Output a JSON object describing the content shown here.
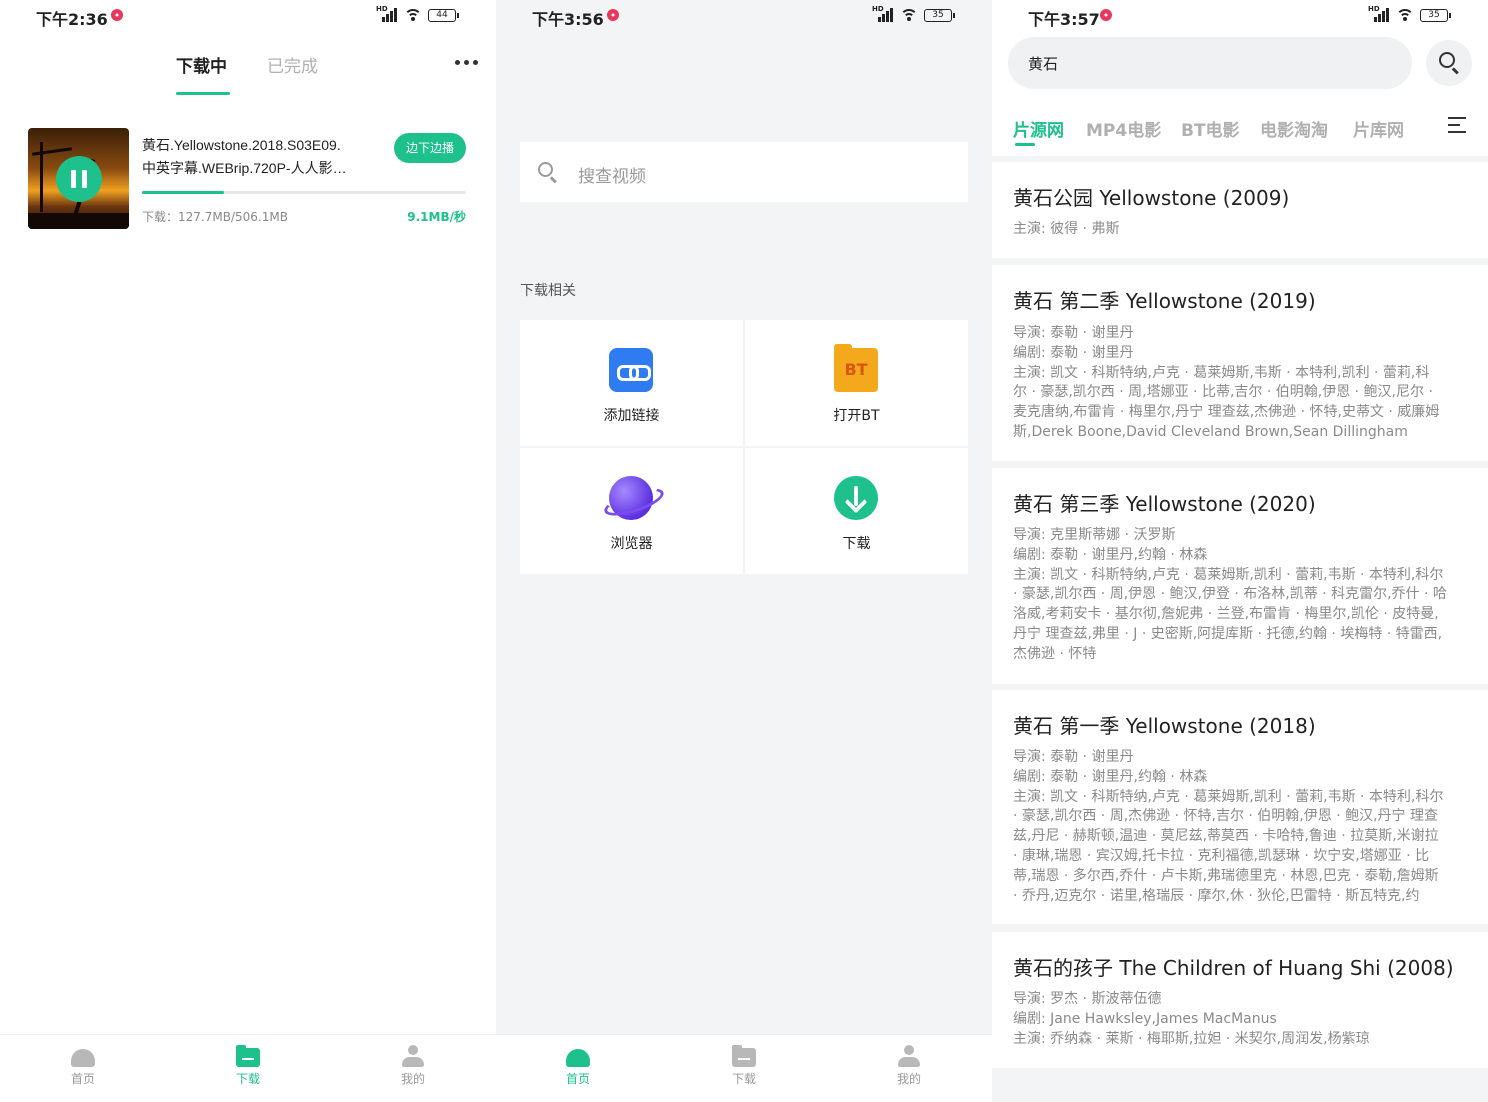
{
  "panel1": {
    "status": {
      "time": "下午2:36",
      "battery": "44"
    },
    "tabs": [
      "下载中",
      "已完成"
    ],
    "item": {
      "title_line1": "黄石.Yellowstone.2018.S03E09.",
      "title_line2": "中英字幕.WEBrip.720P-人人影…",
      "stream_button": "边下边播",
      "size": "下载：127.7MB/506.1MB",
      "speed": "9.1MB/秒",
      "progress": 0.252
    },
    "nav": [
      "首页",
      "下载",
      "我的"
    ]
  },
  "panel2": {
    "status": {
      "time": "下午3:56",
      "battery": "35"
    },
    "search_placeholder": "搜查视频",
    "section_title": "下载相关",
    "grid": [
      {
        "label": "添加链接",
        "icon": "link-icon"
      },
      {
        "label": "打开BT",
        "icon": "bt-folder-icon"
      },
      {
        "label": "浏览器",
        "icon": "planet-icon"
      },
      {
        "label": "下载",
        "icon": "download-icon"
      }
    ],
    "bt_glyph": "BT",
    "nav": [
      "首页",
      "下载",
      "我的"
    ]
  },
  "panel3": {
    "status": {
      "time": "下午3:57",
      "battery": "35"
    },
    "search_value": "黄石",
    "source_tabs": [
      "片源网",
      "MP4电影",
      "BT电影",
      "电影淘淘",
      "片库网"
    ],
    "results": [
      {
        "title": "黄石公园 Yellowstone (2009)",
        "lines": [
          "主演: 彼得 · 弗斯"
        ]
      },
      {
        "title": "黄石 第二季 Yellowstone (2019)",
        "lines": [
          "导演: 泰勒 · 谢里丹",
          "编剧: 泰勒 · 谢里丹",
          "主演: 凯文 · 科斯特纳,卢克 · 葛莱姆斯,韦斯 · 本特利,凯利 · 蕾莉,科",
          "尔 · 豪瑟,凯尔西 · 周,塔娜亚 · 比蒂,吉尔 · 伯明翰,伊恩 · 鲍汉,尼尔 ·",
          "麦克唐纳,布雷肯 · 梅里尔,丹宁 理查兹,杰佛逊 · 怀特,史蒂文 · 威廉姆",
          "斯,Derek Boone,David Cleveland Brown,Sean Dillingham"
        ]
      },
      {
        "title": "黄石 第三季 Yellowstone (2020)",
        "lines": [
          "导演: 克里斯蒂娜 · 沃罗斯",
          "编剧: 泰勒 · 谢里丹,约翰 · 林森",
          "主演: 凯文 · 科斯特纳,卢克 · 葛莱姆斯,凯利 · 蕾莉,韦斯 · 本特利,科尔",
          "· 豪瑟,凯尔西 · 周,伊恩 · 鲍汉,伊登 · 布洛林,凯蒂 · 科克雷尔,乔什 · 哈",
          "洛威,考莉安卡 · 基尔彻,詹妮弗 · 兰登,布雷肯 · 梅里尔,凯伦 · 皮特曼,",
          "丹宁 理查兹,弗里 · J · 史密斯,阿提库斯 · 托德,约翰 · 埃梅特 · 特雷西,",
          "杰佛逊 · 怀特"
        ]
      },
      {
        "title": "黄石 第一季 Yellowstone (2018)",
        "lines": [
          "导演: 泰勒 · 谢里丹",
          "编剧: 泰勒 · 谢里丹,约翰 · 林森",
          "主演: 凯文 · 科斯特纳,卢克 · 葛莱姆斯,凯利 · 蕾莉,韦斯 · 本特利,科尔",
          "· 豪瑟,凯尔西 · 周,杰佛逊 · 怀特,吉尔 · 伯明翰,伊恩 · 鲍汉,丹宁 理查",
          "兹,丹尼 · 赫斯顿,温迪 · 莫尼兹,蒂莫西 · 卡哈特,鲁迪 · 拉莫斯,米谢拉",
          "· 康琳,瑞恩 · 宾汉姆,托卡拉 · 克利福德,凯瑟琳 · 坎宁安,塔娜亚 · 比",
          "蒂,瑞恩 · 多尔西,乔什 · 卢卡斯,弗瑞德里克 · 林恩,巴克 · 泰勒,詹姆斯",
          "· 乔丹,迈克尔 · 诺里,格瑞辰 · 摩尔,休 · 狄伦,巴雷特 · 斯瓦特克,约"
        ]
      },
      {
        "title": "黄石的孩子 The Children of Huang Shi (2008)",
        "lines": [
          "导演: 罗杰 · 斯波蒂伍德",
          "编剧: Jane Hawksley,James MacManus",
          "主演: 乔纳森 · 莱斯 · 梅耶斯,拉妲 · 米契尔,周润发,杨紫琼"
        ]
      }
    ]
  },
  "colors": {
    "accent": "#1ec08b",
    "record_dot": "#e8385b"
  }
}
